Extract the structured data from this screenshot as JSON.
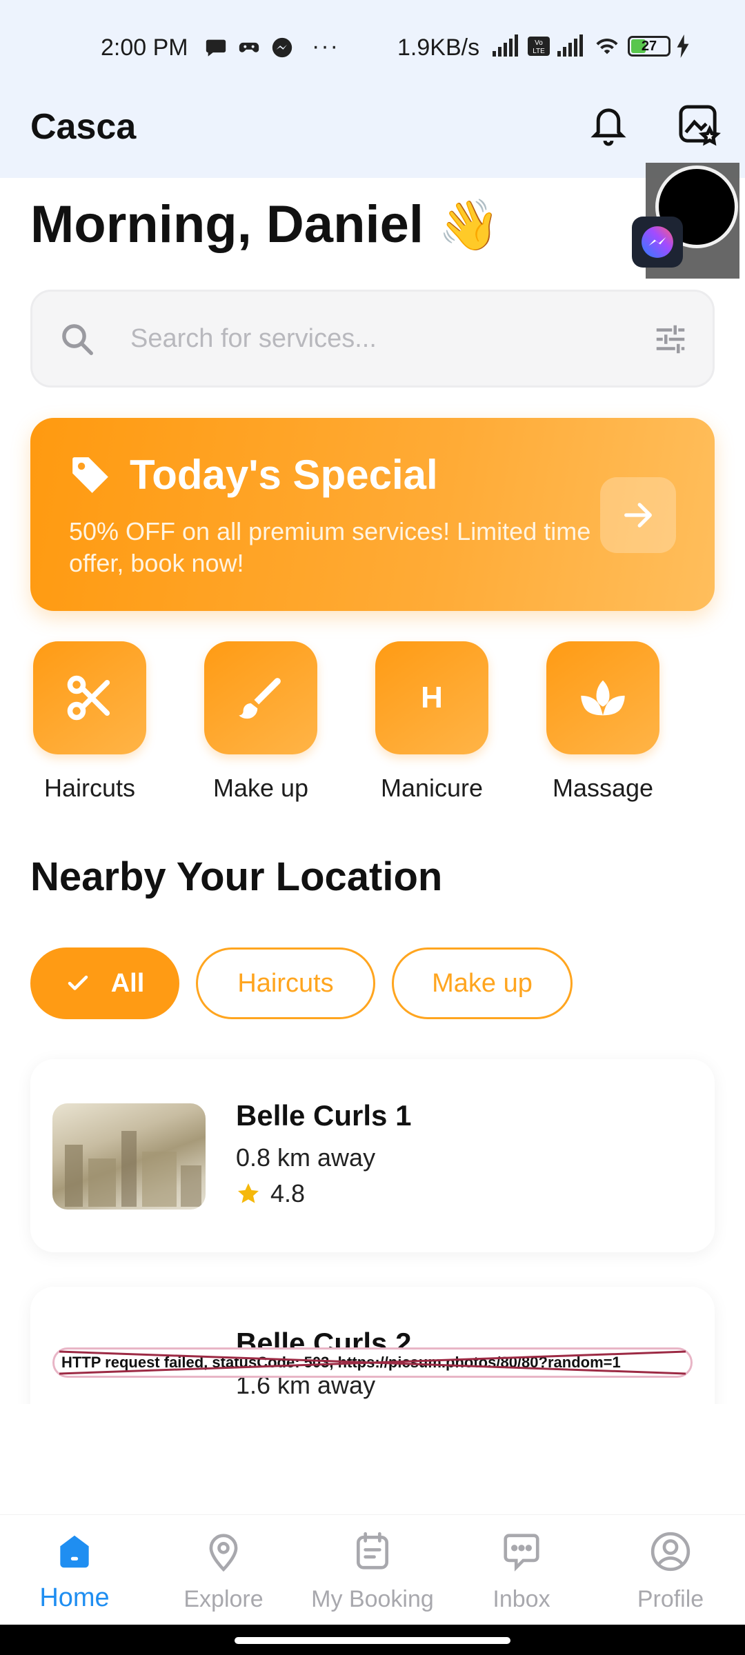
{
  "status_bar": {
    "time": "2:00 PM",
    "more": "···",
    "net_speed": "1.9KB/s",
    "battery": "27"
  },
  "app_bar": {
    "title": "Casca"
  },
  "greeting": {
    "text": "Morning, Daniel",
    "emoji": "👋"
  },
  "search": {
    "placeholder": "Search for services..."
  },
  "special": {
    "title": "Today's Special",
    "description": "50% OFF on all premium services! Limited time offer, book now!"
  },
  "categories": [
    {
      "label": "Haircuts",
      "icon": "scissors-icon"
    },
    {
      "label": "Make up",
      "icon": "brush-icon"
    },
    {
      "label": "Manicure",
      "icon": "H"
    },
    {
      "label": "Massage",
      "icon": "spa-icon"
    }
  ],
  "nearby": {
    "title": "Nearby Your Location",
    "chips": [
      {
        "label": "All",
        "active": true
      },
      {
        "label": "Haircuts",
        "active": false
      },
      {
        "label": "Make up",
        "active": false
      }
    ]
  },
  "salons": [
    {
      "name": "Belle Curls 1",
      "distance": "0.8 km away",
      "rating": "4.8"
    },
    {
      "name": "Belle Curls 2",
      "distance": "1.6 km away",
      "image_error": "HTTP request failed, statusCode: 503, https://picsum.photos/80/80?random=1"
    }
  ],
  "bottom_nav": [
    {
      "label": "Home",
      "icon": "home-icon",
      "active": true
    },
    {
      "label": "Explore",
      "icon": "location-pin-icon",
      "active": false
    },
    {
      "label": "My Booking",
      "icon": "calendar-icon",
      "active": false
    },
    {
      "label": "Inbox",
      "icon": "chat-icon",
      "active": false
    },
    {
      "label": "Profile",
      "icon": "profile-icon",
      "active": false
    }
  ],
  "colors": {
    "accent": "#ff9b14",
    "nav_active": "#1f8ef1",
    "top_bg": "#edf3fd",
    "star": "#f5b80b"
  }
}
